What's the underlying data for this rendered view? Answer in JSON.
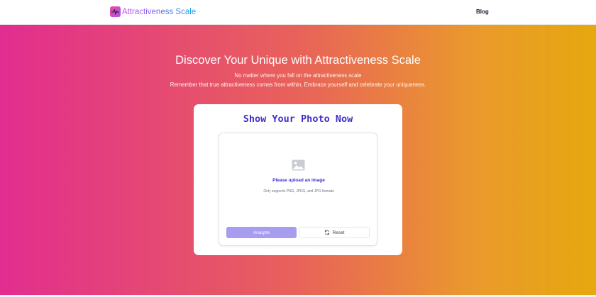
{
  "nav": {
    "brand": "Attractiveness Scale",
    "brand_icon": "heartbeat-pulse-icon",
    "blog_link": "Blog"
  },
  "hero": {
    "title": "Discover Your Unique with Attractiveness Scale",
    "subtitle_line1": "No matter where you fall on the attractiveness scale",
    "subtitle_line2": "Remember that true attractiveness comes from within, Embrace yourself and celebrate your uniqueness.",
    "gradient_colors": [
      "#e22d8f",
      "#e8625a",
      "#ea9a2c",
      "#e6a80e"
    ]
  },
  "card": {
    "title": "Show Your Photo Now",
    "upload": {
      "icon": "image-placeholder-icon",
      "prompt": "Please upload an image",
      "hint": "Only supports PNG, JPEG, and JPG formats"
    },
    "buttons": {
      "analyze_label": "Analyze",
      "reset_label": "Reset",
      "reset_icon": "refresh-icon"
    }
  },
  "colors": {
    "accent": "#3f2fc9",
    "analyze_button": "#a69cf0"
  }
}
